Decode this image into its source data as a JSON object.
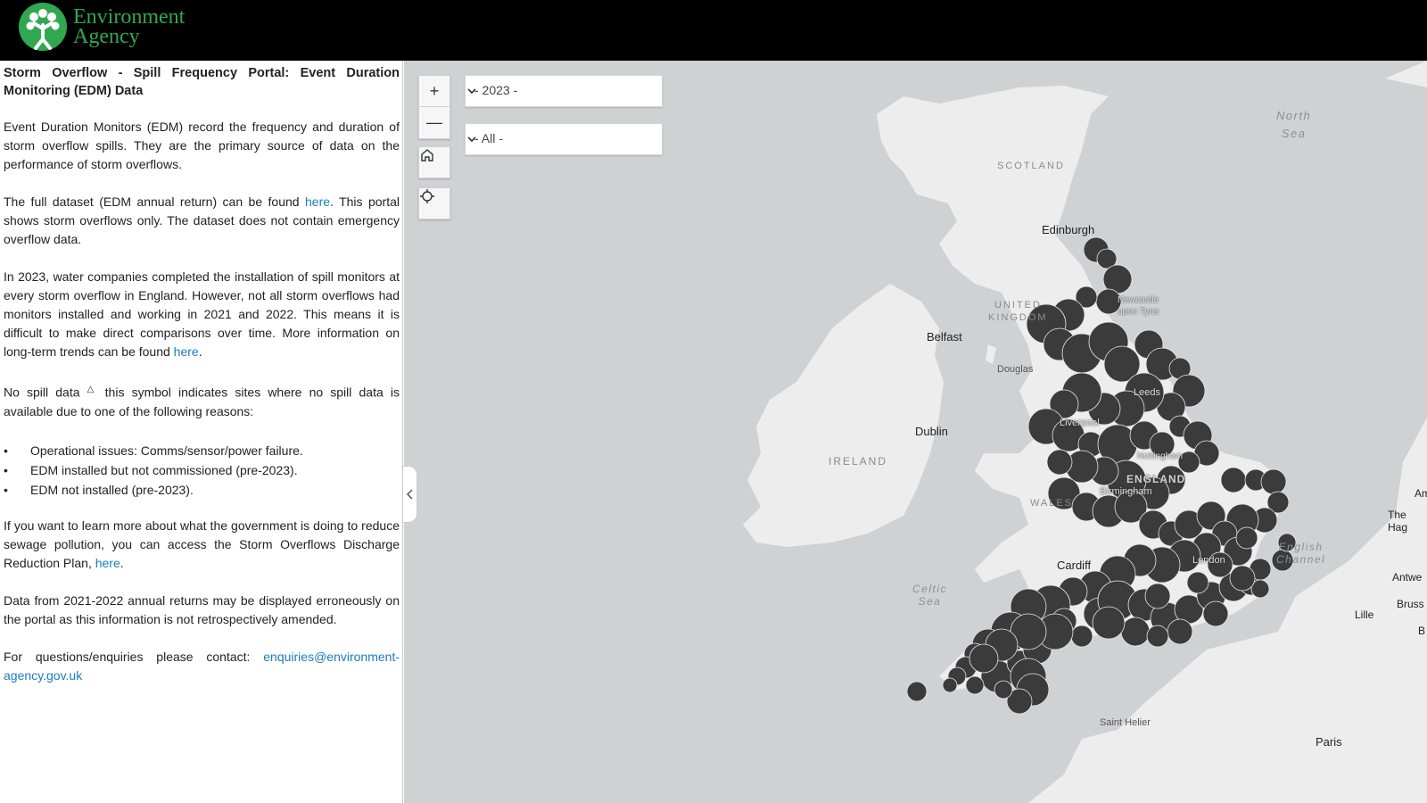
{
  "header": {
    "logo_line1": "Environment",
    "logo_line2": "Agency"
  },
  "panel": {
    "title": "Storm Overflow - Spill Frequency Portal: Event Duration Monitoring (EDM) Data",
    "p1": "Event Duration Monitors (EDM) record the frequency and duration of storm overflow spills. They are the primary source of data on the performance of storm overflows.",
    "p2_before": "The full dataset (EDM annual return) can be found ",
    "p2_link": "here",
    "p2_after": ". This portal shows storm overflows only. The dataset does not contain emergency overflow data.",
    "p3_before": "In 2023, water companies completed the installation of spill monitors at every storm overflow in England. However, not all storm overflows had monitors installed and working in 2021 and 2022. This means it is difficult to make direct comparisons over time. More information on long-term trends can be found ",
    "p3_link": "here",
    "p3_after": ".",
    "p4_before": "No spill data ",
    "p4_symbol": "△",
    "p4_after": " this symbol indicates sites where no spill data is available due to one of the following reasons:",
    "bullets": [
      "Operational issues: Comms/sensor/power failure.",
      "EDM installed but not commissioned (pre-2023).",
      "EDM not installed (pre-2023)."
    ],
    "p5_before": "If you want to learn more about what the government is doing to reduce sewage pollution, you can access the Storm Overflows Discharge Reduction Plan, ",
    "p5_link": "here",
    "p5_after": ".",
    "p6": "Data from 2021-2022 annual returns may be displayed erroneously on the portal as this information is not retrospectively amended.",
    "p7_before": "For questions/enquiries please contact: ",
    "p7_link": "enquiries@environment-agency.gov.uk"
  },
  "map": {
    "zoom_in": "+",
    "zoom_out": "—",
    "year_select": "- 2023 -",
    "filter_select": "- All -",
    "labels": {
      "north_sea": "North\nSea",
      "scotland": "SCOTLAND",
      "edinburgh": "Edinburgh",
      "united_kingdom_1": "UNITED",
      "united_kingdom_2": "KINGDOM",
      "belfast": "Belfast",
      "douglas": "Douglas",
      "ireland": "IRELAND",
      "dublin": "Dublin",
      "wales": "WALES",
      "cardiff": "Cardiff",
      "celtic_sea": "Celtic\nSea",
      "saint_helier": "Saint Helier",
      "paris": "Paris",
      "lille": "Lille",
      "english_channel": "English\nChannel",
      "london": "London",
      "england": "ENGLAND",
      "birmingham": "Birmingham",
      "nottingham": "Nottingham",
      "liverpool": "Liverpool",
      "leeds": "Leeds",
      "newcastle": "Newcastle\nupon Tyne",
      "the_hague": "The Hag",
      "am": "Am",
      "antwerp": "Antwe",
      "brussels": "Bruss",
      "b": "B"
    }
  }
}
